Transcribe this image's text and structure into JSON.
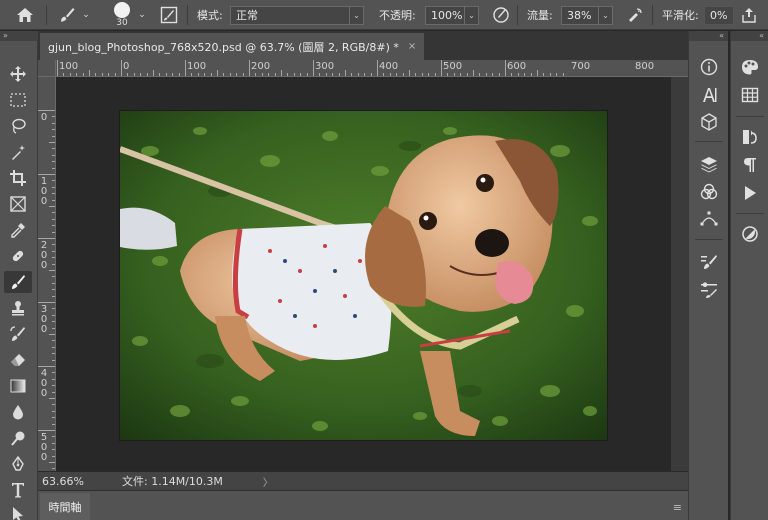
{
  "options_bar": {
    "brush_size": "30",
    "mode_label": "模式:",
    "mode_value": "正常",
    "opacity_label": "不透明:",
    "opacity_value": "100%",
    "flow_label": "流量:",
    "flow_value": "38%",
    "smoothing_label": "平滑化:",
    "smoothing_value": "0%"
  },
  "collapse_glyph": "»",
  "expand_glyph": "«",
  "document_tab": {
    "title": "gjun_blog_Photoshop_768x520.psd @ 63.7% (圖層 2, RGB/8#) *",
    "close": "×"
  },
  "ruler": {
    "horizontal_labels": [
      "100",
      "0",
      "100",
      "200",
      "300",
      "400",
      "500",
      "600",
      "700",
      "800"
    ],
    "vertical_labels": [
      "0",
      "1",
      "0",
      "0",
      "2",
      "0",
      "0",
      "3",
      "0",
      "0",
      "4",
      "0",
      "0",
      "5",
      "0",
      "0"
    ]
  },
  "tools": [
    {
      "name": "move-tool",
      "icon": "move-icon"
    },
    {
      "name": "marquee-tool",
      "icon": "marquee-icon"
    },
    {
      "name": "lasso-tool",
      "icon": "lasso-icon"
    },
    {
      "name": "magic-wand-tool",
      "icon": "magic-wand-icon"
    },
    {
      "name": "crop-tool",
      "icon": "crop-icon"
    },
    {
      "name": "frame-tool",
      "icon": "frame-icon"
    },
    {
      "name": "eyedropper-tool",
      "icon": "eyedropper-icon"
    },
    {
      "name": "healing-brush-tool",
      "icon": "bandage-icon"
    },
    {
      "name": "brush-tool",
      "icon": "brush-icon",
      "active": true
    },
    {
      "name": "stamp-tool",
      "icon": "stamp-icon"
    },
    {
      "name": "history-brush-tool",
      "icon": "history-brush-icon"
    },
    {
      "name": "eraser-tool",
      "icon": "eraser-icon"
    },
    {
      "name": "gradient-tool",
      "icon": "gradient-icon"
    },
    {
      "name": "blur-tool",
      "icon": "drop-icon"
    },
    {
      "name": "dodge-tool",
      "icon": "dodge-icon"
    },
    {
      "name": "pen-tool",
      "icon": "pen-icon"
    },
    {
      "name": "type-tool",
      "icon": "type-icon"
    },
    {
      "name": "path-selection-tool",
      "icon": "arrow-icon"
    }
  ],
  "status": {
    "zoom": "63.66%",
    "doc_size": "文件: 1.14M/10.3M",
    "arrow": "〉"
  },
  "timeline": {
    "tab_label": "時間軸",
    "menu": "≡"
  },
  "panel_icons_1": [
    "info-icon",
    "character-icon",
    "3d-icon",
    "layers-icon",
    "channels-icon",
    "paths-icon",
    "brush-settings-icon",
    "brush-presets-icon"
  ],
  "panel_icons_2": [
    "color-palette-icon",
    "swatches-grid-icon",
    "history-icon",
    "paragraph-icon",
    "play-icon",
    "adjustments-icon"
  ],
  "colors": {
    "ui_bg": "#535353",
    "canvas_bg": "#282828",
    "grass": "#3b6a23",
    "shirt": "#e9ecf1",
    "dog": "#d6a77e",
    "collar": "#c73e43"
  }
}
